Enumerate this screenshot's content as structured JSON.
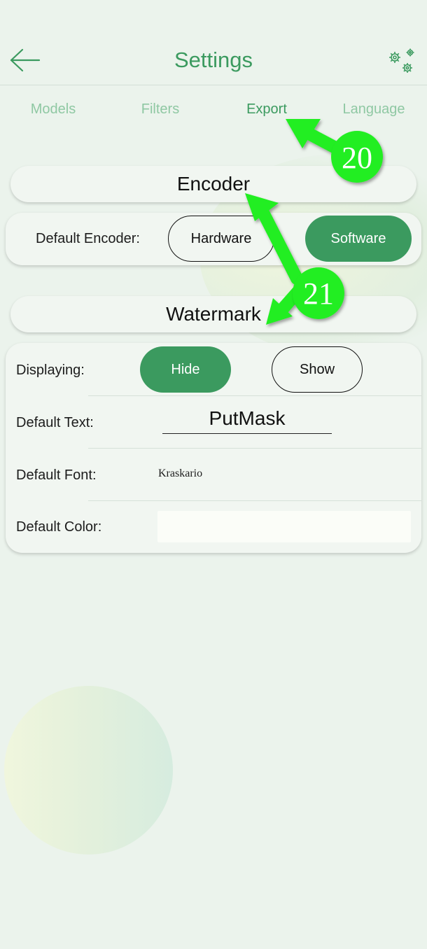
{
  "header": {
    "title": "Settings",
    "back_icon": "arrow-left-icon",
    "settings_icon": "gears-icon"
  },
  "tabs": [
    {
      "label": "Models",
      "active": false
    },
    {
      "label": "Filters",
      "active": false
    },
    {
      "label": "Export",
      "active": true
    },
    {
      "label": "Language",
      "active": false
    }
  ],
  "encoder": {
    "title": "Encoder",
    "default_label": "Default Encoder:",
    "options": [
      "Hardware",
      "Software"
    ],
    "selected": "Software"
  },
  "watermark": {
    "title": "Watermark",
    "displaying_label": "Displaying:",
    "displaying_options": [
      "Hide",
      "Show"
    ],
    "displaying_selected": "Hide",
    "text_label": "Default Text:",
    "text_value": "PutMask",
    "font_label": "Default Font:",
    "font_value": "Kraskario",
    "color_label": "Default Color:",
    "color_value": "#fbfdf8"
  },
  "annotations": [
    {
      "label": "20",
      "color": "#22ee22"
    },
    {
      "label": "21",
      "color": "#22ee22"
    }
  ],
  "colors": {
    "accent": "#3b9a5f",
    "tab_inactive": "#8fc8a3",
    "background": "#ebf3ec"
  }
}
